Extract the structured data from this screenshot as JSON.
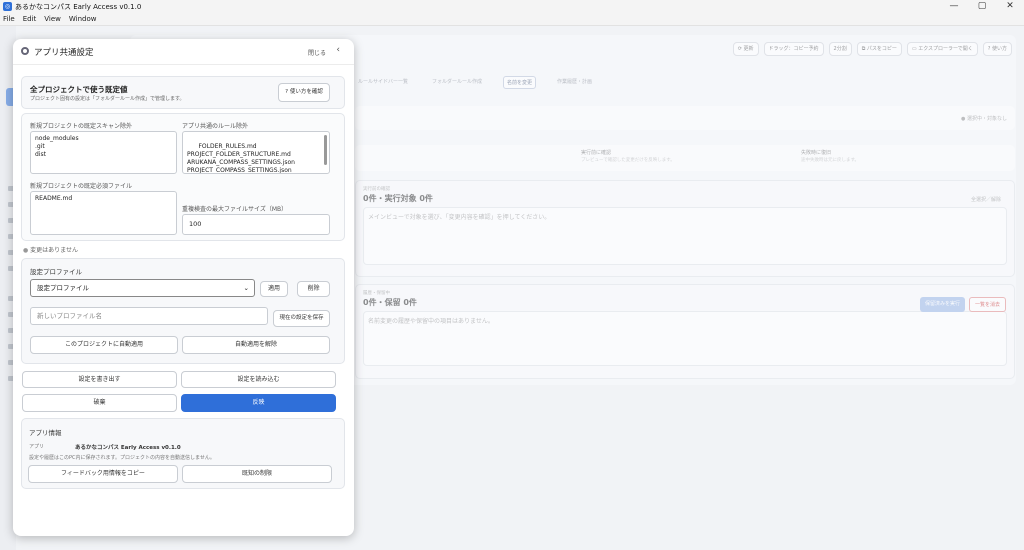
{
  "window": {
    "title": "あるかなコンパス Early Access v0.1.0",
    "controls": [
      "—",
      "▢",
      "✕"
    ]
  },
  "menu": [
    "File",
    "Edit",
    "View",
    "Window"
  ],
  "background": {
    "toolbar": [
      "⟳ 更新",
      "ドラッグ：コピー予約",
      "2分割",
      "⧉ パスをコピー",
      "▭ エクスプローラーで開く",
      "? 使い方"
    ],
    "tabs": [
      "ルールサイドバー一覧",
      "フォルダールール作成",
      "名前を変更",
      "作業履歴・計画"
    ],
    "selected_tab": "名前を変更",
    "strip_right": "● 選択中・対象なし",
    "cols": [
      {
        "title": "",
        "sub": ""
      },
      {
        "title": "実行前に確認",
        "sub": "プレビューで確認した変更だけを反映します。"
      },
      {
        "title": "失敗時に復旧",
        "sub": "途中失敗時は元に戻します。"
      }
    ],
    "card1": {
      "caption": "実行前の確認",
      "heading": "0件・実行対象 0件",
      "body": "メインビューで対象を選び、「変更内容を確認」を押してください。",
      "action": "全選択／解除"
    },
    "card2": {
      "caption": "履歴・保留中",
      "heading": "0件・保留 0件",
      "body": "名前変更の履歴や保留中の項目はありません。",
      "action1": "保留済みを実行",
      "action2": "一覧を消去"
    }
  },
  "dialog": {
    "title": "アプリ共通設定",
    "close_label": "閉じる",
    "defaults": {
      "title": "全プロジェクトで使う既定値",
      "subtitle": "プロジェクト固有の設定は「フォルダールール作成」で管理します。",
      "help_button": "使い方を確認"
    },
    "scan_exclude": {
      "label": "新規プロジェクトの既定スキャン除外",
      "value": "node_modules\n.git\ndist"
    },
    "rule_exclude": {
      "label": "アプリ共通のルール除外",
      "value": "FOLDER_RULES.md\nPROJECT_FOLDER_STRUCTURE.md\nARUKANA_COMPASS_SETTINGS.json\nPROJECT_COMPASS_SETTINGS.json\nproject_compass.json"
    },
    "required_files": {
      "label": "新規プロジェクトの既定必須ファイル",
      "value": "README.md"
    },
    "max_size": {
      "label": "重複検査の最大ファイルサイズ（MB）",
      "value": "100"
    },
    "status": "変更はありません",
    "profiles": {
      "label": "設定プロファイル",
      "selected": "設定プロファイル",
      "apply": "適用",
      "delete": "削除",
      "new_placeholder": "新しいプロファイル名",
      "save_current": "現在の設定を保存",
      "auto_apply": "このプロジェクトに自動適用",
      "cancel_auto": "自動適用を解除"
    },
    "export": "設定を書き出す",
    "import": "設定を読み込む",
    "discard": "破棄",
    "apply_all": "反映",
    "app_info": {
      "title": "アプリ情報",
      "app_key": "アプリ",
      "app_value": "あるかなコンパス Early Access v0.1.0",
      "note": "設定や履歴はこのPC内に保存されます。プロジェクトの内容を自動送信しません。",
      "copy_feedback": "フィードバック用情報をコピー",
      "limits": "既知の制限"
    }
  }
}
